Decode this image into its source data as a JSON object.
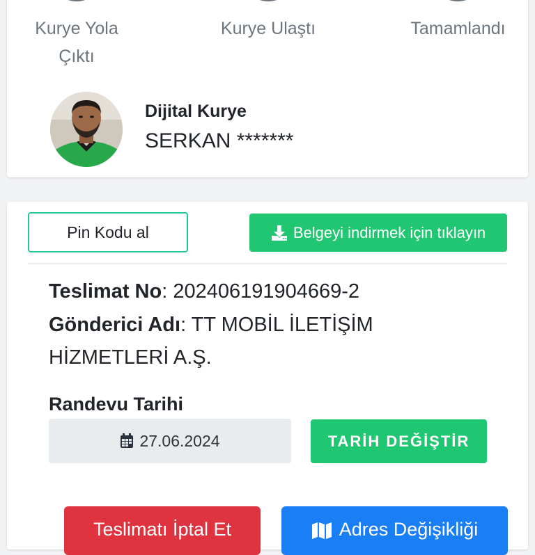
{
  "steps": [
    {
      "line1": "Kurye Yola",
      "line2": "Çıktı"
    },
    {
      "line1": "Kurye Ulaştı"
    },
    {
      "line1": "Tamamlandı"
    }
  ],
  "courier": {
    "title": "Dijital Kurye",
    "name": "SERKAN *******"
  },
  "actions": {
    "pin_label": "Pin Kodu al",
    "download_label": "Belgeyi indirmek için tıklayın"
  },
  "delivery": {
    "number_label": "Teslimat No",
    "number_value": ": 202406191904669-2",
    "sender_label": "Gönderici Adı",
    "sender_value_line1": ": TT MOBİL İLETİŞİM",
    "sender_value_line2": "HİZMETLERİ A.Ş."
  },
  "appointment": {
    "label": "Randevu Tarihi",
    "date": "27.06.2024",
    "change_label": "TARİH DEĞİŞTİR"
  },
  "bottom": {
    "cancel_label": "Teslimatı İptal Et",
    "address_label": "Adres Değişikliği"
  },
  "colors": {
    "accent_green": "#20c671",
    "danger_red": "#e03340",
    "primary_blue": "#1a7ff5",
    "step_gray": "#6c757d"
  }
}
